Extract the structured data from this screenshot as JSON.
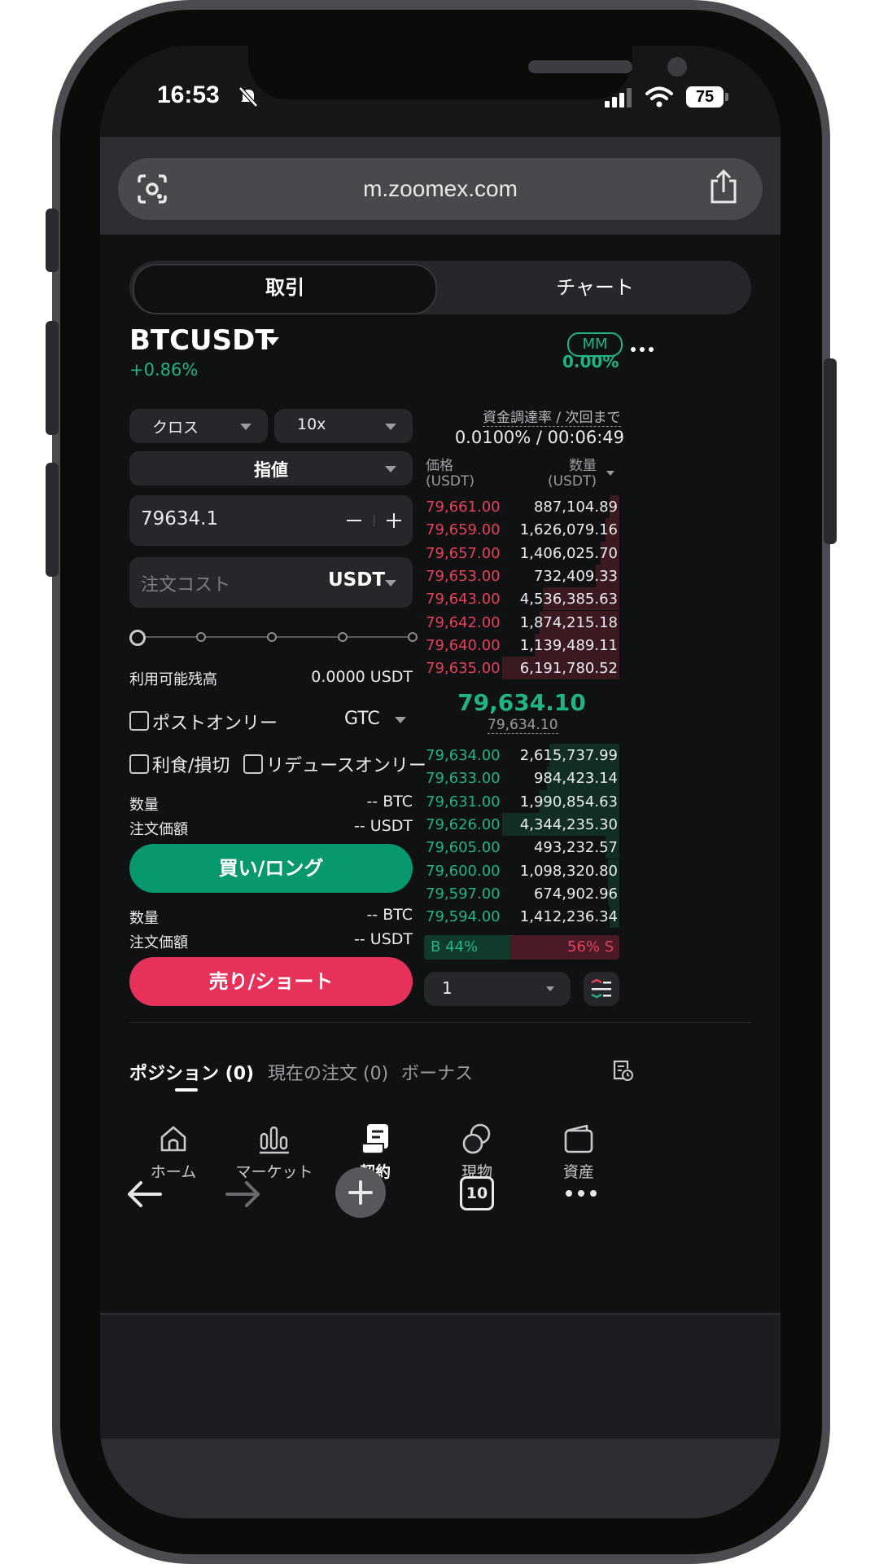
{
  "status": {
    "time": "16:53",
    "battery": "75"
  },
  "browser": {
    "url": "m.zoomex.com",
    "tab_count": "10"
  },
  "tabs": {
    "trade": "取引",
    "chart": "チャート"
  },
  "pair": {
    "symbol": "BTCUSDT",
    "change": "+0.86%",
    "mm_label": "MM",
    "mm_value": "0.00%"
  },
  "order_form": {
    "margin_mode": "クロス",
    "leverage": "10x",
    "order_type": "指値",
    "price": "79634.1",
    "cost_placeholder": "注文コスト",
    "cost_unit": "USDT",
    "available_label": "利用可能残高",
    "available_value": "0.0000 USDT",
    "post_only": "ポストオンリー",
    "tif": "GTC",
    "tpsl": "利食/損切",
    "reduce_only": "リデュースオンリー",
    "qty_label": "数量",
    "qty_value": "-- BTC",
    "value_label": "注文価額",
    "value_value": "-- USDT",
    "buy_label": "買い/ロング",
    "sell_label": "売り/ショート",
    "slider_level_pct": 0
  },
  "orderbook": {
    "funding_label": "資金調達率 / 次回まで",
    "funding_value": "0.0100% / 00:06:49",
    "price_header": "価格",
    "price_unit": "(USDT)",
    "qty_header": "数量",
    "qty_unit": "(USDT)",
    "asks": [
      {
        "price": "79,661.00",
        "qty": "887,104.89",
        "depth": 0.08
      },
      {
        "price": "79,659.00",
        "qty": "1,626,079.16",
        "depth": 0.12
      },
      {
        "price": "79,657.00",
        "qty": "1,406,025.70",
        "depth": 0.16
      },
      {
        "price": "79,653.00",
        "qty": "732,409.33",
        "depth": 0.2
      },
      {
        "price": "79,643.00",
        "qty": "4,536,385.63",
        "depth": 0.65
      },
      {
        "price": "79,642.00",
        "qty": "1,874,215.18",
        "depth": 0.68
      },
      {
        "price": "79,640.00",
        "qty": "1,139,489.11",
        "depth": 0.72
      },
      {
        "price": "79,635.00",
        "qty": "6,191,780.52",
        "depth": 1.0
      }
    ],
    "last_price": "79,634.10",
    "mark_price": "79,634.10",
    "bids": [
      {
        "price": "79,634.00",
        "qty": "2,615,737.99",
        "depth": 0.6
      },
      {
        "price": "79,633.00",
        "qty": "984,423.14",
        "depth": 0.62
      },
      {
        "price": "79,631.00",
        "qty": "1,990,854.63",
        "depth": 0.68
      },
      {
        "price": "79,626.00",
        "qty": "4,344,235.30",
        "depth": 1.0
      },
      {
        "price": "79,605.00",
        "qty": "493,232.57",
        "depth": 0.12
      },
      {
        "price": "79,600.00",
        "qty": "1,098,320.80",
        "depth": 0.1
      },
      {
        "price": "79,597.00",
        "qty": "674,902.96",
        "depth": 0.1
      },
      {
        "price": "79,594.00",
        "qty": "1,412,236.34",
        "depth": 0.08
      }
    ],
    "buy_ratio": "B 44%",
    "sell_ratio": "56% S",
    "buy_pct": 44,
    "precision": "1"
  },
  "bottom_tabs": {
    "positions": "ポジション (0)",
    "orders": "現在の注文 (0)",
    "bonus": "ボーナス"
  },
  "nav": {
    "home": "ホーム",
    "market": "マーケット",
    "contract": "契約",
    "spot": "現物",
    "assets": "資産"
  },
  "colors": {
    "buy": "#07986d",
    "sell": "#e6325a",
    "accent_green": "#20b482",
    "accent_red": "#e7415a"
  }
}
